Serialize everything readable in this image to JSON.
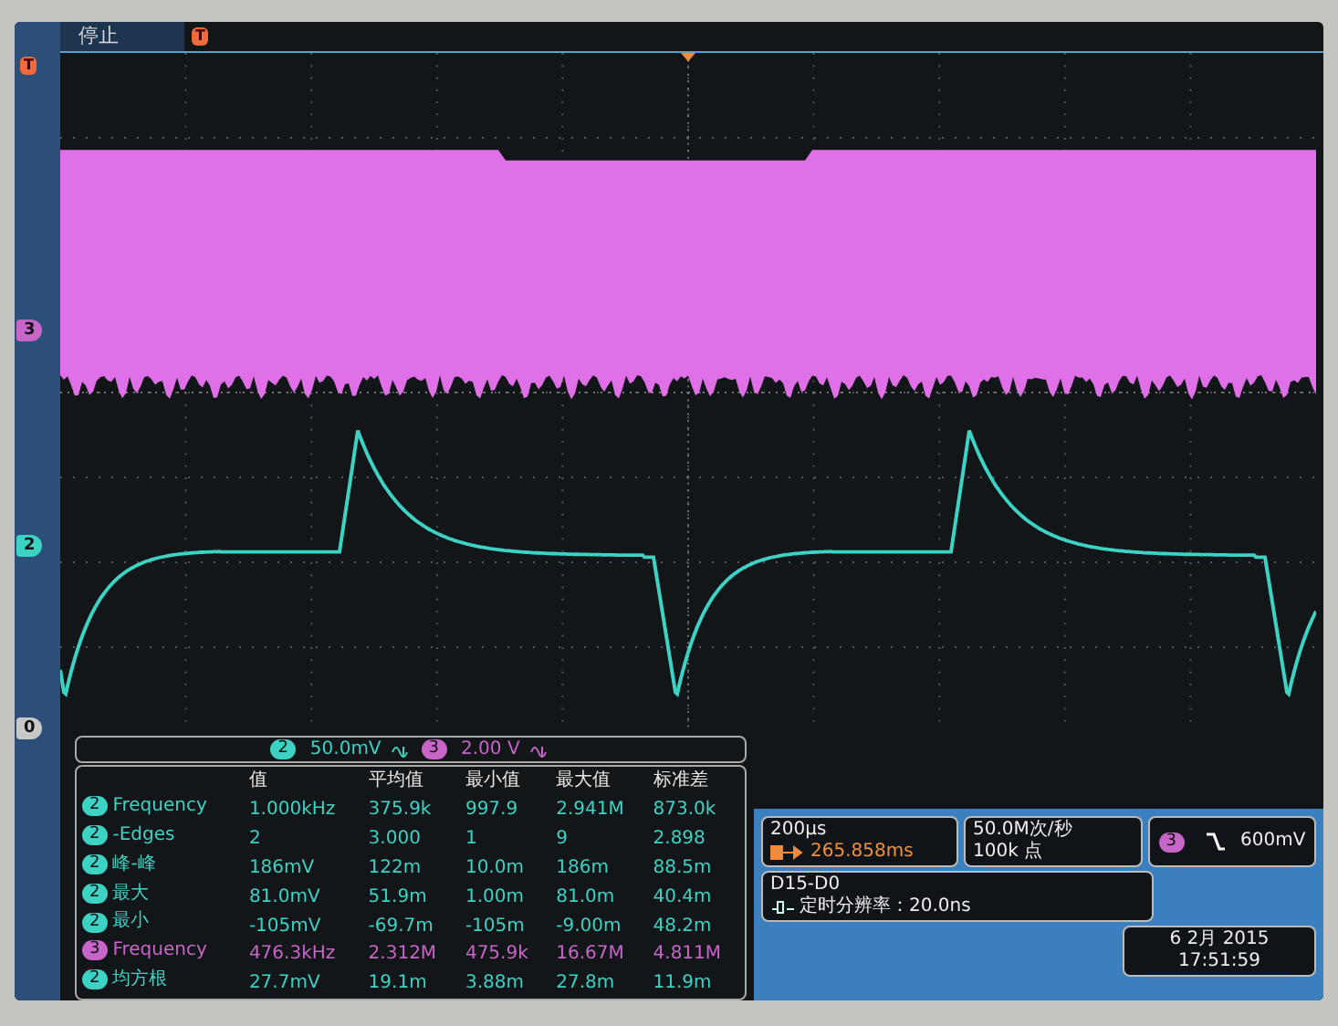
{
  "top_bar": {
    "status": "停止",
    "trigger_marker": "T"
  },
  "plot": {
    "trigger_marker": "T",
    "markers": [
      {
        "label": "3",
        "color": "#c865c8"
      },
      {
        "label": "2",
        "color": "#3cd2c4"
      },
      {
        "label": "0",
        "color": "#c8c8c8"
      }
    ]
  },
  "scale_bar": [
    {
      "channel": "2",
      "scale": "50.0mV",
      "color": "#3cd2c4"
    },
    {
      "channel": "3",
      "scale": "2.00 V",
      "color": "#c865c8"
    }
  ],
  "measurements": {
    "columns": [
      "值",
      "平均值",
      "最小值",
      "最大值",
      "标准差"
    ],
    "rows": [
      {
        "channel": "2",
        "name": "Frequency",
        "color": "#3cd2c4",
        "values": [
          "1.000kHz",
          "375.9k",
          "997.9",
          "2.941M",
          "873.0k"
        ]
      },
      {
        "channel": "2",
        "name": "-Edges",
        "color": "#3cd2c4",
        "values": [
          "2",
          "3.000",
          "1",
          "9",
          "2.898"
        ]
      },
      {
        "channel": "2",
        "name": "峰-峰",
        "color": "#3cd2c4",
        "values": [
          "186mV",
          "122m",
          "10.0m",
          "186m",
          "88.5m"
        ]
      },
      {
        "channel": "2",
        "name": "最大",
        "color": "#3cd2c4",
        "values": [
          "81.0mV",
          "51.9m",
          "1.00m",
          "81.0m",
          "40.4m"
        ]
      },
      {
        "channel": "2",
        "name": "最小",
        "color": "#3cd2c4",
        "values": [
          "-105mV",
          "-69.7m",
          "-105m",
          "-9.00m",
          "48.2m"
        ]
      },
      {
        "channel": "3",
        "name": "Frequency",
        "color": "#c865c8",
        "values": [
          "476.3kHz",
          "2.312M",
          "475.9k",
          "16.67M",
          "4.811M"
        ]
      },
      {
        "channel": "2",
        "name": "均方根",
        "color": "#3cd2c4",
        "values": [
          "27.7mV",
          "19.1m",
          "3.88m",
          "27.8m",
          "11.9m"
        ]
      }
    ]
  },
  "timebase": {
    "scale": "200µs",
    "trigger_position": "265.858ms"
  },
  "acquisition": {
    "sample_rate": "50.0M次/秒",
    "record_length": "100k 点"
  },
  "trigger": {
    "channel": "3",
    "color": "#c865c8",
    "level": "600mV"
  },
  "digital": {
    "channels": "D15-D0",
    "timing_resolution": "定时分辨率：20.0ns"
  },
  "clock": {
    "date": "6 2月 2015",
    "time": "17:51:59"
  }
}
